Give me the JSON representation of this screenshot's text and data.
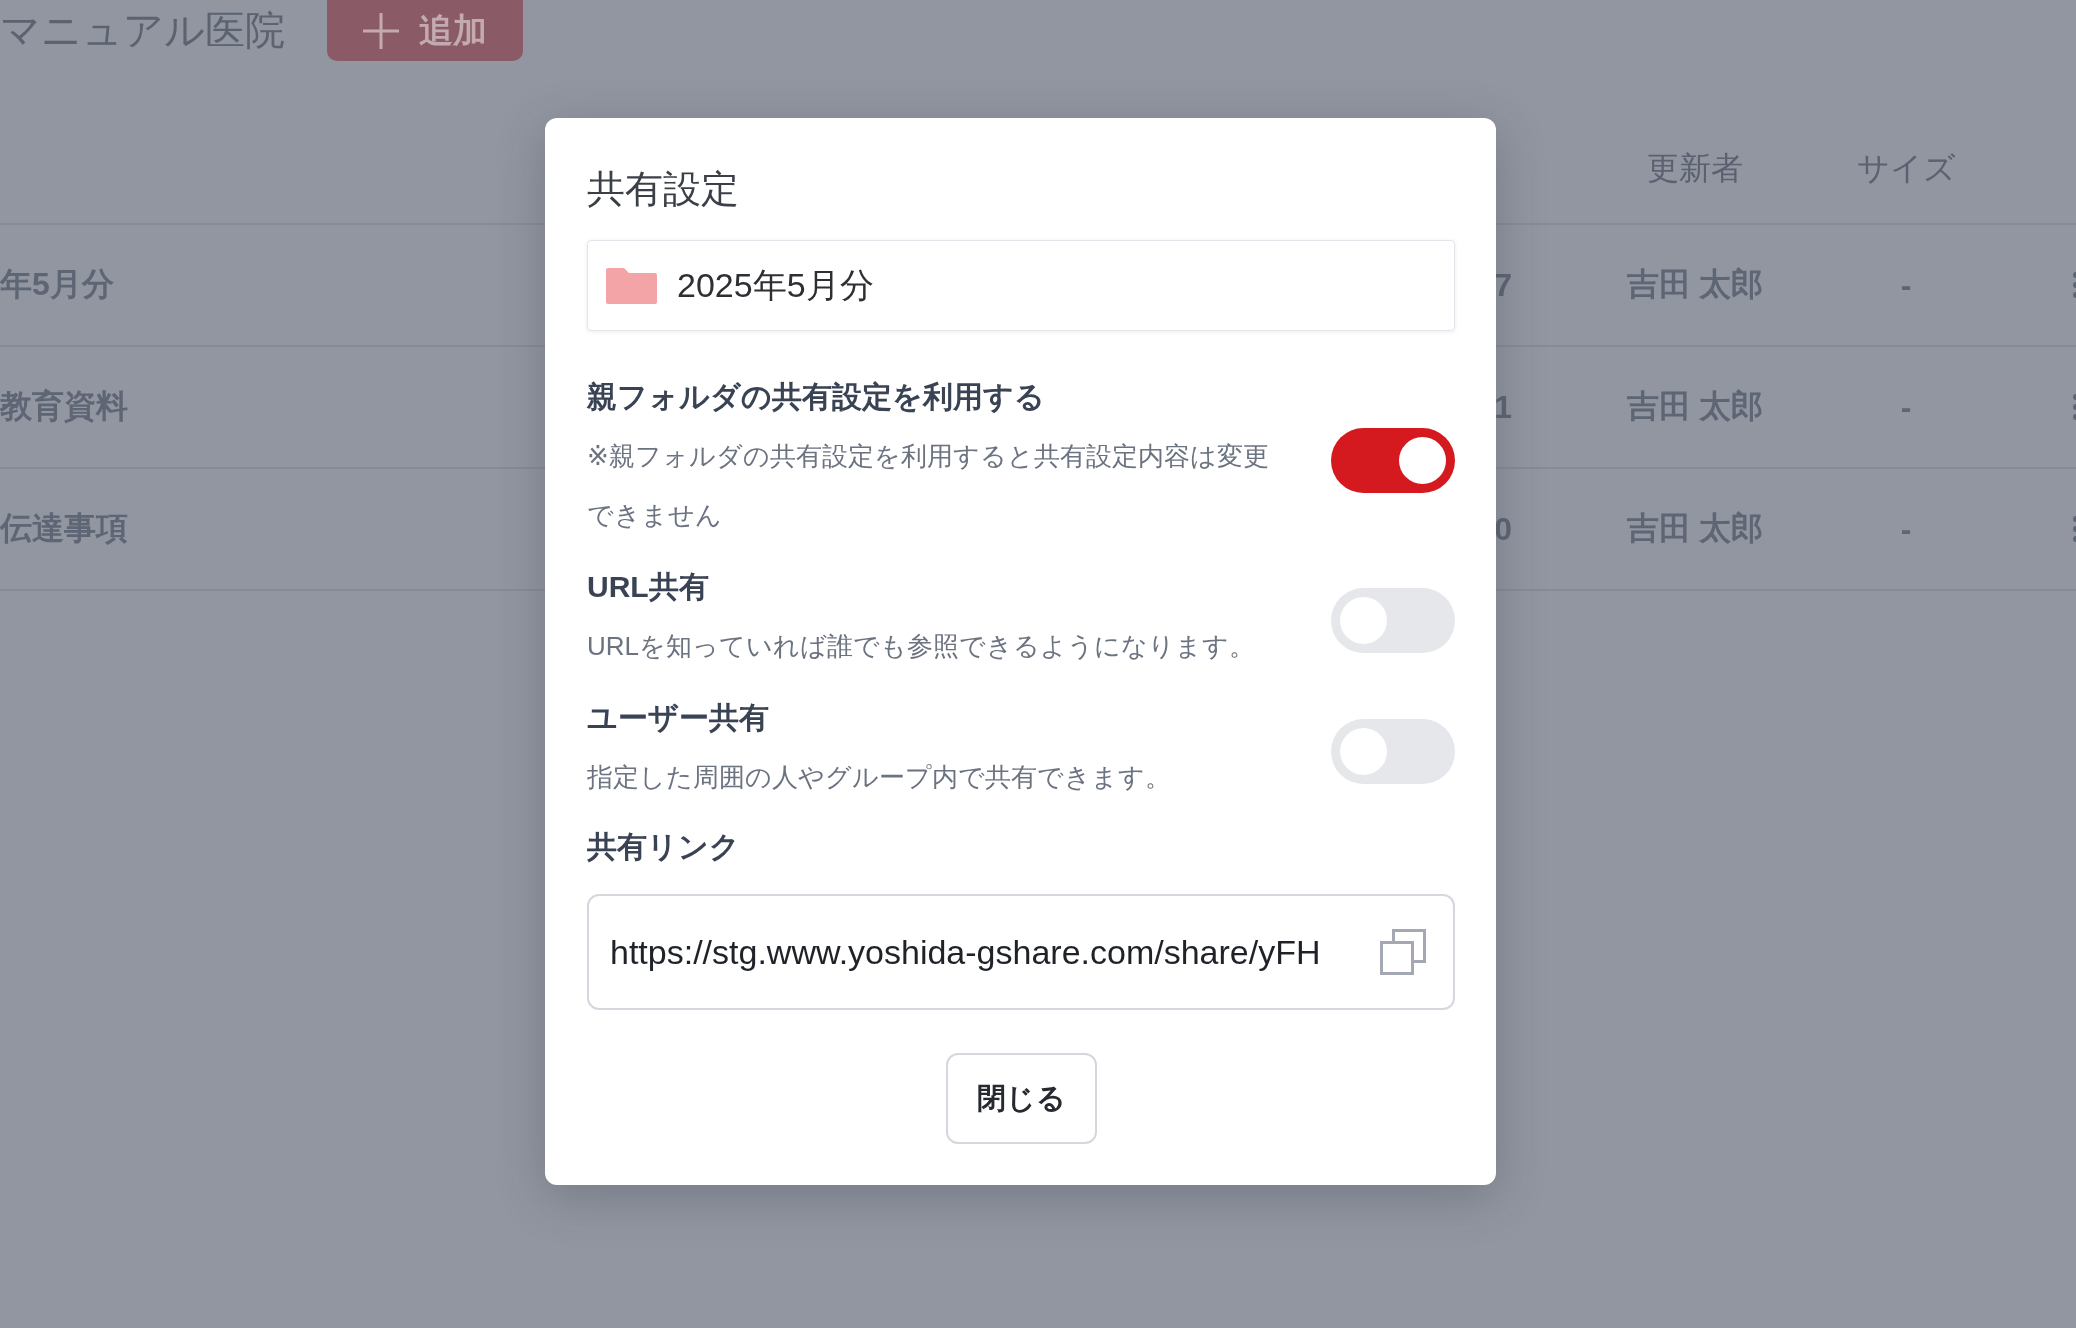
{
  "page": {
    "title": "マニュアル医院",
    "add_button": "追加"
  },
  "table": {
    "columns": {
      "updater": "更新者",
      "size": "サイズ"
    },
    "rows": [
      {
        "column_1": "年5月分",
        "column_2": "7",
        "updater": "吉田 太郎",
        "size": "-"
      },
      {
        "column_1": "教育資料",
        "column_2": "1",
        "updater": "吉田 太郎",
        "size": "-"
      },
      {
        "column_1": "伝達事項",
        "column_2": "0",
        "updater": "吉田 太郎",
        "size": "-"
      }
    ]
  },
  "dialog": {
    "title": "共有設定",
    "folder": {
      "name": "2025年5月分"
    },
    "settings": [
      {
        "label": "親フォルダの共有設定を利用する",
        "description": "※親フォルダの共有設定を利用すると共有設定内容は変更できません",
        "on": true
      },
      {
        "label": "URL共有",
        "description": "URLを知っていれば誰でも参照できるようになります。",
        "on": false
      },
      {
        "label": "ユーザー共有",
        "description": "指定した周囲の人やグループ内で共有できます。",
        "on": false
      }
    ],
    "share_link": {
      "label": "共有リンク",
      "value": "https://stg.www.yoshida-gshare.com/share/yFH"
    },
    "close_button": "閉じる"
  }
}
